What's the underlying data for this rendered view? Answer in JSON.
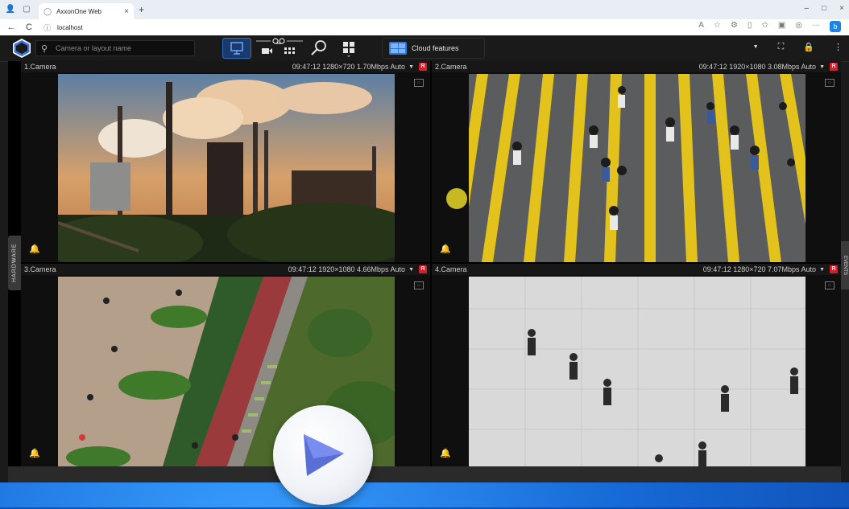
{
  "browser": {
    "tab_title": "AxxonOne Web",
    "url": "localhost",
    "new_tab_label": "+"
  },
  "toolbar": {
    "search_placeholder": "Camera or layout name",
    "cloud_label": "Cloud features"
  },
  "side_panels": {
    "left_label": "HARDWARE",
    "right_label": "EVENTS"
  },
  "cameras": [
    {
      "name": "1.Camera",
      "meta": "09:47:12  1280×720 1.70Mbps Auto",
      "rec": "R"
    },
    {
      "name": "2.Camera",
      "meta": "09:47:12  1920×1080 3.08Mbps Auto",
      "rec": "R"
    },
    {
      "name": "3.Camera",
      "meta": "09:47:12  1920×1080 4.66Mbps Auto",
      "rec": "R"
    },
    {
      "name": "4.Camera",
      "meta": "09:47:12  1280×720 7.07Mbps Auto",
      "rec": "R"
    }
  ],
  "icons": {
    "tab_close": "×",
    "back": "←",
    "reload": "C",
    "info": "ⓘ",
    "bell": "🔔",
    "caret": "▼",
    "minimize": "–",
    "maximize": "□",
    "close": "×",
    "more": "⋮"
  }
}
